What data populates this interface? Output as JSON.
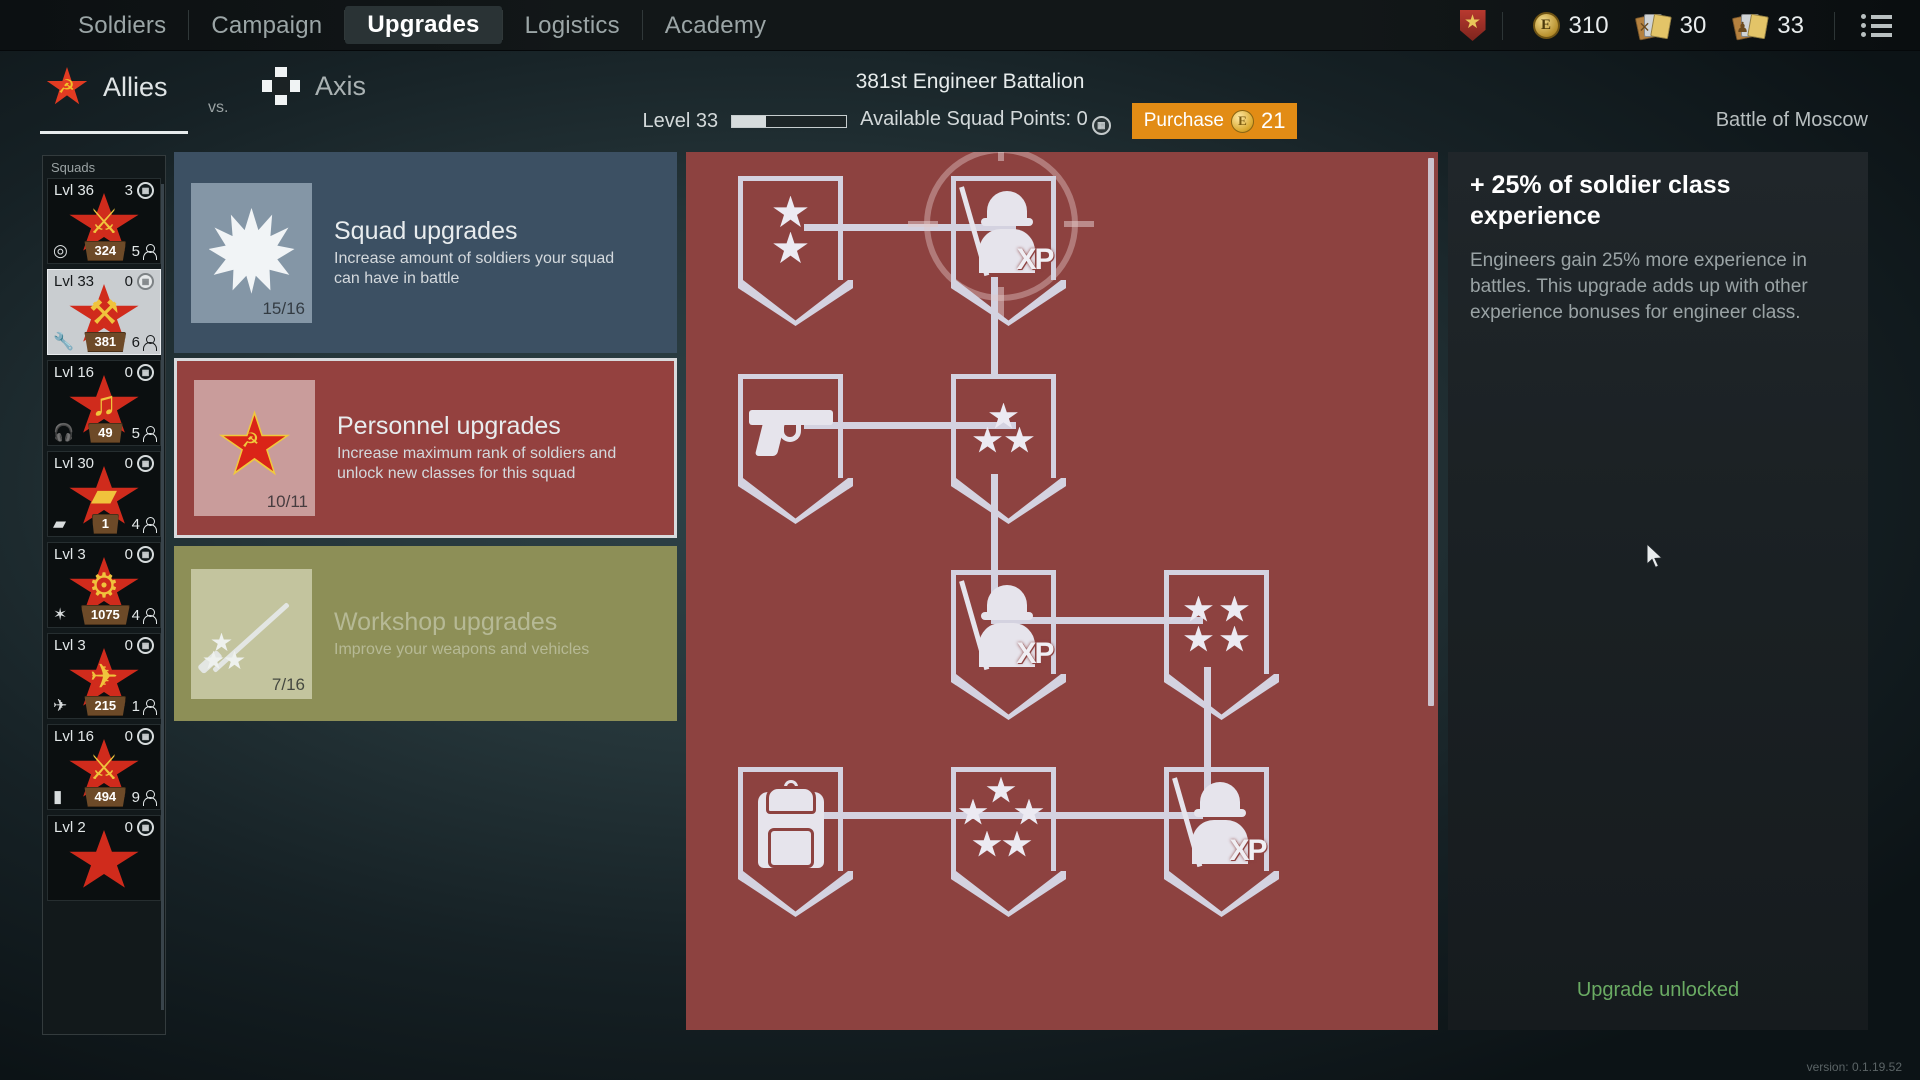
{
  "topbar": {
    "nav": [
      {
        "label": "Soldiers",
        "active": false
      },
      {
        "label": "Campaign",
        "active": false
      },
      {
        "label": "Upgrades",
        "active": true
      },
      {
        "label": "Logistics",
        "active": false
      },
      {
        "label": "Academy",
        "active": false
      }
    ],
    "rank_star": "★",
    "currencies": [
      {
        "icon": "coin-e-icon",
        "symbol": "E",
        "value": "310"
      },
      {
        "icon": "weapon-cards-icon",
        "value": "30"
      },
      {
        "icon": "soldier-cards-icon",
        "value": "33"
      }
    ],
    "menu_icon": "list-menu-icon"
  },
  "factions": {
    "allies": {
      "label": "Allies",
      "icon": "soviet-star-icon",
      "selected": true
    },
    "vs": "vs.",
    "axis": {
      "label": "Axis",
      "icon": "iron-cross-icon",
      "selected": false
    },
    "campaign": "Battle of Moscow"
  },
  "battalion": {
    "title": "381st Engineer Battalion",
    "level_label": "Level 33",
    "xp_percent": 30,
    "points_label": "Available Squad Points: 0",
    "points_icon": "squad-point-icon",
    "purchase_label": "Purchase",
    "purchase_cost": "21",
    "purchase_coin_symbol": "E"
  },
  "squads": {
    "header": "Squads",
    "items": [
      {
        "level": "Lvl 36",
        "points": "3",
        "badge": "324",
        "men": "5",
        "class_glyph": "◎",
        "emblem_glyph": "⚔",
        "selected": false
      },
      {
        "level": "Lvl 33",
        "points": "0",
        "badge": "381",
        "men": "6",
        "class_glyph": "🔧",
        "emblem_glyph": "⚒",
        "selected": true
      },
      {
        "level": "Lvl 16",
        "points": "0",
        "badge": "49",
        "men": "5",
        "class_glyph": "🎧",
        "emblem_glyph": "♫",
        "selected": false
      },
      {
        "level": "Lvl 30",
        "points": "0",
        "badge": "1",
        "men": "4",
        "class_glyph": "▰",
        "emblem_glyph": "▰",
        "selected": false
      },
      {
        "level": "Lvl 3",
        "points": "0",
        "badge": "1075",
        "men": "4",
        "class_glyph": "✶",
        "emblem_glyph": "⚙",
        "selected": false
      },
      {
        "level": "Lvl 3",
        "points": "0",
        "badge": "215",
        "men": "1",
        "class_glyph": "✈",
        "emblem_glyph": "✈",
        "selected": false
      },
      {
        "level": "Lvl 16",
        "points": "0",
        "badge": "494",
        "men": "9",
        "class_glyph": "▮",
        "emblem_glyph": "⚔",
        "selected": false
      },
      {
        "level": "Lvl 2",
        "points": "0",
        "badge": "",
        "men": "",
        "class_glyph": "",
        "emblem_glyph": "",
        "selected": false
      }
    ]
  },
  "categories": [
    {
      "title": "Squad upgrades",
      "desc": "Increase amount of soldiers your squad can have in battle",
      "progress": "15/16",
      "icon": "burst-icon",
      "theme": "blue",
      "selected": false,
      "locked": false
    },
    {
      "title": "Personnel upgrades",
      "desc": "Increase maximum rank of soldiers and unlock new classes for this squad",
      "progress": "10/11",
      "icon": "soviet-star-icon",
      "theme": "red",
      "selected": true,
      "locked": false
    },
    {
      "title": "Workshop upgrades",
      "desc": "Improve your weapons and vehicles",
      "progress": "7/16",
      "icon": "rifle-stars-icon",
      "theme": "olive",
      "selected": false,
      "locked": true
    }
  ],
  "tree": {
    "nodes": [
      {
        "id": "n-rank-2",
        "icon": "two-stars-shield-icon",
        "selected": false
      },
      {
        "id": "n-xp-1",
        "icon": "soldier-xp-shield-icon",
        "selected": true
      },
      {
        "id": "n-pistol",
        "icon": "pistol-shield-icon",
        "selected": false
      },
      {
        "id": "n-rank-3",
        "icon": "three-stars-shield-icon",
        "selected": false
      },
      {
        "id": "n-xp-2",
        "icon": "soldier-xp-shield-icon",
        "selected": false
      },
      {
        "id": "n-rank-4",
        "icon": "four-stars-shield-icon",
        "selected": false
      },
      {
        "id": "n-backpack",
        "icon": "backpack-shield-icon",
        "selected": false
      },
      {
        "id": "n-rank-5",
        "icon": "five-stars-shield-icon",
        "selected": false
      },
      {
        "id": "n-xp-3",
        "icon": "soldier-xp-shield-icon",
        "selected": false
      }
    ],
    "panel_color": "#8d4240"
  },
  "info": {
    "title": "+ 25% of soldier class experience",
    "description": "Engineers gain 25% more experience in battles. This upgrade adds up with other experience bonuses for engineer class.",
    "status": "Upgrade unlocked",
    "status_color": "#6aab63"
  },
  "version": "version: 0.1.19.52"
}
